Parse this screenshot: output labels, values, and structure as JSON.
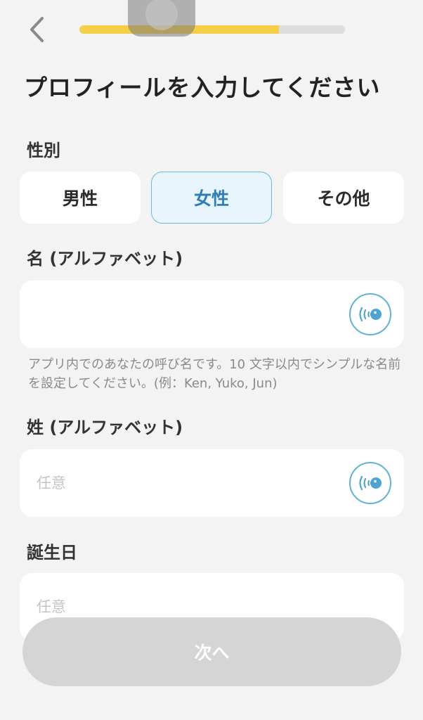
{
  "header": {
    "progress_percent": 75
  },
  "title": "プロフィールを入力してください",
  "gender": {
    "label": "性別",
    "options": [
      "男性",
      "女性",
      "その他"
    ],
    "selected": "女性"
  },
  "first_name": {
    "label": "名 (アルファベット)",
    "value": "",
    "placeholder": "",
    "hint": "アプリ内でのあなたの呼び名です。10 文字以内でシンプルな名前を設定してください。(例：Ken, Yuko, Jun)"
  },
  "last_name": {
    "label": "姓 (アルファベット)",
    "placeholder": "任意"
  },
  "birthday": {
    "label": "誕生日",
    "placeholder": "任意"
  },
  "footer": {
    "next_label": "次へ"
  },
  "colors": {
    "accent": "#6db8dd",
    "progress": "#f6cf48",
    "disabled": "#d5d5d5"
  }
}
